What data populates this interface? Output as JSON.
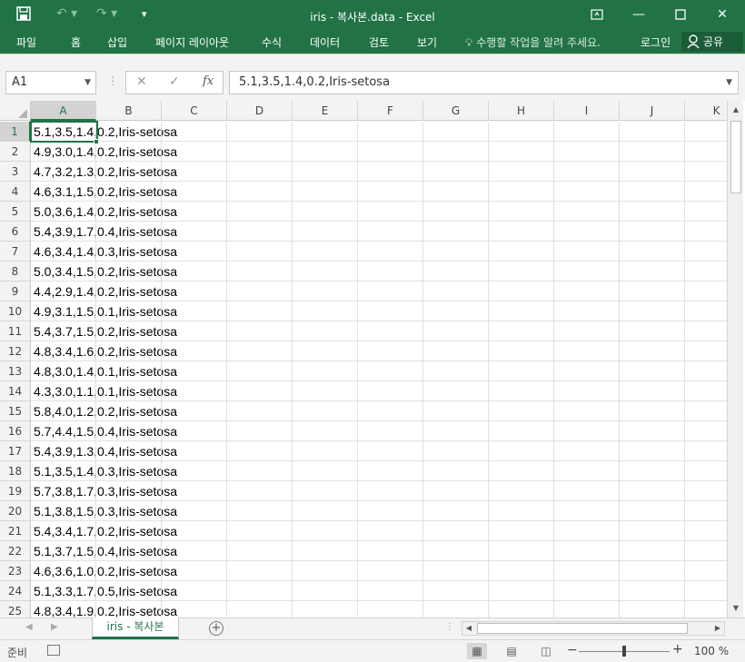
{
  "window": {
    "title": "iris - 복사본.data - Excel",
    "minimize": "—",
    "restore": "❐",
    "close": "✕"
  },
  "quick_access": {
    "save_icon": "save-icon",
    "undo_icon": "undo-icon",
    "redo_icon": "redo-icon",
    "customize_icon": "customize-icon"
  },
  "ribbon": {
    "tabs": [
      "파일",
      "홈",
      "삽입",
      "페이지 레이아웃",
      "수식",
      "데이터",
      "검토",
      "보기"
    ],
    "tell_me": "수행할 작업을 알려 주세요.",
    "login": "로그인",
    "share": "공유"
  },
  "formula_bar": {
    "name_box": "A1",
    "fx_label": "fx",
    "cancel": "✕",
    "enter": "✓",
    "content": "5.1,3.5,1.4,0.2,Iris-setosa"
  },
  "columns": [
    "A",
    "B",
    "C",
    "D",
    "E",
    "F",
    "G",
    "H",
    "I",
    "J",
    "K"
  ],
  "rows": [
    {
      "n": "1",
      "a": "5.1,3.5,1.4,0.2,Iris-setosa"
    },
    {
      "n": "2",
      "a": "4.9,3.0,1.4,0.2,Iris-setosa"
    },
    {
      "n": "3",
      "a": "4.7,3.2,1.3,0.2,Iris-setosa"
    },
    {
      "n": "4",
      "a": "4.6,3.1,1.5,0.2,Iris-setosa"
    },
    {
      "n": "5",
      "a": "5.0,3.6,1.4,0.2,Iris-setosa"
    },
    {
      "n": "6",
      "a": "5.4,3.9,1.7,0.4,Iris-setosa"
    },
    {
      "n": "7",
      "a": "4.6,3.4,1.4,0.3,Iris-setosa"
    },
    {
      "n": "8",
      "a": "5.0,3.4,1.5,0.2,Iris-setosa"
    },
    {
      "n": "9",
      "a": "4.4,2.9,1.4,0.2,Iris-setosa"
    },
    {
      "n": "10",
      "a": "4.9,3.1,1.5,0.1,Iris-setosa"
    },
    {
      "n": "11",
      "a": "5.4,3.7,1.5,0.2,Iris-setosa"
    },
    {
      "n": "12",
      "a": "4.8,3.4,1.6,0.2,Iris-setosa"
    },
    {
      "n": "13",
      "a": "4.8,3.0,1.4,0.1,Iris-setosa"
    },
    {
      "n": "14",
      "a": "4.3,3.0,1.1,0.1,Iris-setosa"
    },
    {
      "n": "15",
      "a": "5.8,4.0,1.2,0.2,Iris-setosa"
    },
    {
      "n": "16",
      "a": "5.7,4.4,1.5,0.4,Iris-setosa"
    },
    {
      "n": "17",
      "a": "5.4,3.9,1.3,0.4,Iris-setosa"
    },
    {
      "n": "18",
      "a": "5.1,3.5,1.4,0.3,Iris-setosa"
    },
    {
      "n": "19",
      "a": "5.7,3.8,1.7,0.3,Iris-setosa"
    },
    {
      "n": "20",
      "a": "5.1,3.8,1.5,0.3,Iris-setosa"
    },
    {
      "n": "21",
      "a": "5.4,3.4,1.7,0.2,Iris-setosa"
    },
    {
      "n": "22",
      "a": "5.1,3.7,1.5,0.4,Iris-setosa"
    },
    {
      "n": "23",
      "a": "4.6,3.6,1.0,0.2,Iris-setosa"
    },
    {
      "n": "24",
      "a": "5.1,3.3,1.7,0.5,Iris-setosa"
    },
    {
      "n": "25",
      "a": "4.8,3.4,1.9,0.2,Iris-setosa"
    }
  ],
  "sheet_tabs": [
    "iris - 복사본"
  ],
  "status": {
    "ready": "준비",
    "zoom": "100 %"
  },
  "colors": {
    "accent": "#217346"
  }
}
